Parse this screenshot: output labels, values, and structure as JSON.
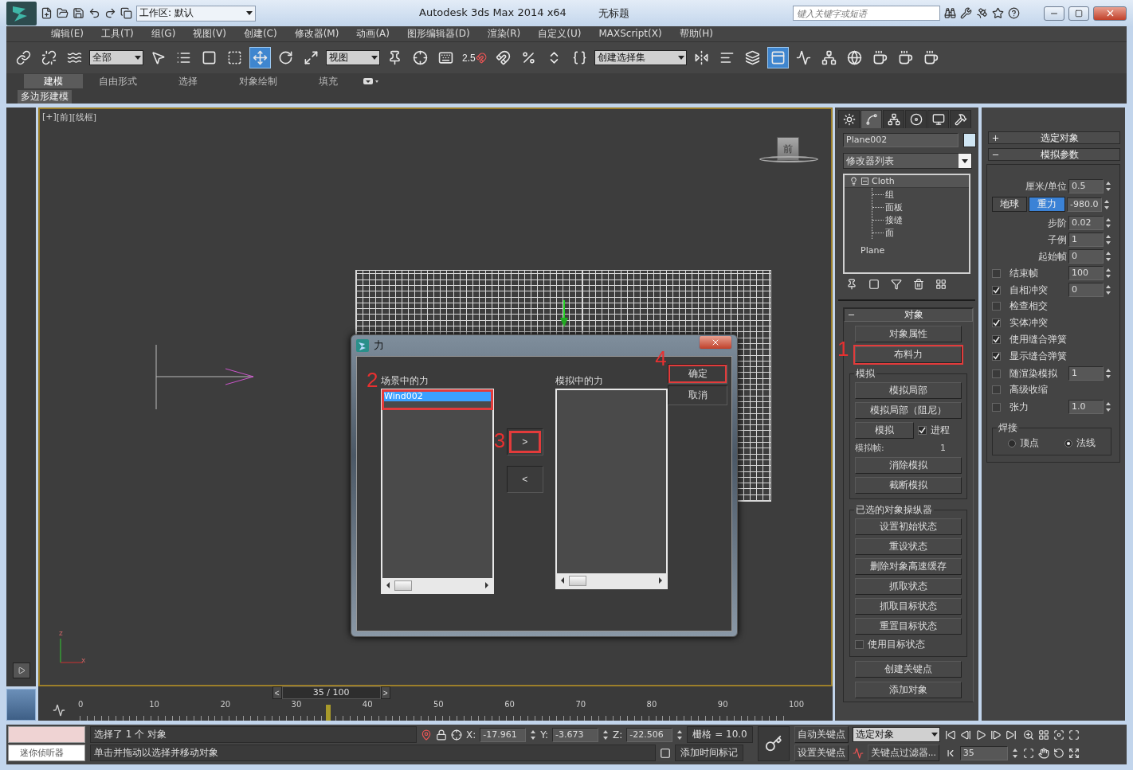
{
  "title_bar": {
    "workspace": "工作区: 默认",
    "title": "Autodesk 3ds Max  2014 x64",
    "document": "无标题",
    "search": {
      "placeholder": "键入关键字或短语"
    }
  },
  "menu": [
    "编辑(E)",
    "工具(T)",
    "组(G)",
    "视图(V)",
    "创建(C)",
    "修改器(M)",
    "动画(A)",
    "图形编辑器(D)",
    "渲染(R)",
    "自定义(U)",
    "MAXScript(X)",
    "帮助(H)"
  ],
  "toolbar": {
    "selection_filter": "全部",
    "reference_coord": "视图",
    "snap_label": "2.5",
    "named_selection": "创建选择集"
  },
  "ribbon": {
    "tabs": [
      {
        "label": "建模",
        "selected": true
      },
      {
        "label": "自由形式",
        "selected": false
      },
      {
        "label": "选择",
        "selected": false
      },
      {
        "label": "对象绘制",
        "selected": false
      },
      {
        "label": "填充",
        "selected": false
      }
    ],
    "panel": "多边形建模"
  },
  "viewport": {
    "labels": [
      "[+]",
      "[前]",
      "[线框]"
    ],
    "view_cube": "前",
    "axis_labels": [
      "z",
      "x"
    ]
  },
  "dialog": {
    "title": "力",
    "scene_forces": {
      "label": "场景中的力",
      "marker": "2",
      "items": [
        {
          "label": "Wind002",
          "selected": true,
          "highlighted": true
        }
      ]
    },
    "move_buttons": [
      {
        "label": ">",
        "highlighted": true,
        "marker": "3"
      },
      {
        "label": "<",
        "highlighted": false
      }
    ],
    "sim_forces": {
      "label": "模拟中的力"
    },
    "buttons": [
      {
        "label": "确定",
        "highlighted": true,
        "marker": "4"
      },
      {
        "label": "取消",
        "highlighted": false
      }
    ]
  },
  "command_panel": {
    "tabs": [
      {
        "kind": "create",
        "selected": false
      },
      {
        "kind": "modify",
        "selected": true
      },
      {
        "kind": "hierarchy",
        "selected": false
      },
      {
        "kind": "motion",
        "selected": false
      },
      {
        "kind": "display",
        "selected": false
      },
      {
        "kind": "utilities",
        "selected": false
      }
    ],
    "object_name": "Plane002",
    "modifier_list": "修改器列表",
    "stack": [
      {
        "label": "Cloth",
        "expanded": true,
        "children": [
          {
            "label": "组"
          },
          {
            "label": "面板"
          },
          {
            "label": "接缝"
          },
          {
            "label": "面"
          }
        ]
      },
      {
        "label": "Plane"
      }
    ],
    "rollout": {
      "title": "对象",
      "expanded": true,
      "buttons": [
        {
          "label": "对象属性",
          "highlighted": false
        },
        {
          "label": "布料力",
          "highlighted": true,
          "marker": "1"
        }
      ],
      "simulation": {
        "title": "模拟",
        "buttons": [
          {
            "label": "模拟局部"
          },
          {
            "label": "模拟局部（阻尼）"
          }
        ],
        "simulate": "模拟",
        "progress": {
          "label": "进程",
          "checked": true
        },
        "frame_label": "模拟帧:",
        "frame_value": "1",
        "more_buttons": [
          {
            "label": "消除模拟"
          },
          {
            "label": "截断模拟"
          }
        ]
      },
      "manipulators": {
        "title": "已选的对象操纵器",
        "buttons": [
          {
            "label": "设置初始状态"
          },
          {
            "label": "重设状态"
          },
          {
            "label": "删除对象高速缓存"
          },
          {
            "label": "抓取状态"
          },
          {
            "label": "抓取目标状态"
          },
          {
            "label": "重置目标状态"
          }
        ],
        "use_target": {
          "label": "使用目标状态",
          "checked": false
        }
      },
      "key_buttons": [
        {
          "label": "创建关键点"
        },
        {
          "label": "添加对象"
        }
      ]
    }
  },
  "sim_params": {
    "rollouts": [
      {
        "title": "选定对象",
        "expanded": false
      },
      {
        "title": "模拟参数",
        "expanded": true
      }
    ],
    "rows": [
      {
        "kind": "field",
        "label": "厘米/单位",
        "value": "0.5"
      },
      {
        "kind": "gravity",
        "earth": "地球",
        "gravity": "重力",
        "gravity_on": true,
        "value": "-980.0"
      },
      {
        "kind": "field",
        "label": "步阶",
        "value": "0.02"
      },
      {
        "kind": "field",
        "label": "子例",
        "value": "1"
      },
      {
        "kind": "field",
        "label": "起始帧",
        "value": "0"
      },
      {
        "kind": "check",
        "label": "结束帧",
        "checked": false,
        "value": "100"
      },
      {
        "kind": "check",
        "label": "自相冲突",
        "checked": true,
        "value": "0"
      },
      {
        "kind": "check",
        "label": "检查相交",
        "checked": false
      },
      {
        "kind": "check",
        "label": "实体冲突",
        "checked": true
      },
      {
        "kind": "check",
        "label": "使用缝合弹簧",
        "checked": true
      },
      {
        "kind": "check",
        "label": "显示缝合弹簧",
        "checked": true
      },
      {
        "kind": "check",
        "label": "随渲染模拟",
        "checked": false,
        "value": "1"
      },
      {
        "kind": "check",
        "label": "高级收缩",
        "checked": false
      },
      {
        "kind": "check",
        "label": "张力",
        "checked": false,
        "value": "1.0"
      }
    ],
    "weld": {
      "title": "焊接",
      "options": [
        {
          "label": "顶点",
          "selected": false
        },
        {
          "label": "法线",
          "selected": true
        }
      ]
    }
  },
  "timeline": {
    "prev": "<",
    "position": "35 / 100",
    "next": ">",
    "level": 0.35,
    "ticks": [
      "0",
      "10",
      "20",
      "30",
      "40",
      "50",
      "60",
      "70",
      "80",
      "90",
      "100"
    ]
  },
  "status": {
    "listener": "迷你侦听器",
    "prompt": "选择了 1 个 对象",
    "hint": "单击并拖动以选择并移动对象",
    "coords": [
      {
        "axis": "X:",
        "value": "-17.961"
      },
      {
        "axis": "Y:",
        "value": "-3.673"
      },
      {
        "axis": "Z:",
        "value": "-22.506"
      }
    ],
    "grid": "栅格 = 10.0",
    "time_tag": "添加时间标记",
    "auto_key": "自动关键点",
    "key_target": "选定对象",
    "set_key": "设置关键点",
    "key_filters": "关键点过滤器...",
    "frame": "35"
  }
}
